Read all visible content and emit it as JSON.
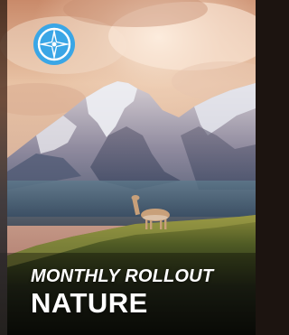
{
  "card": {
    "kicker": "MONTHLY ROLLOUT",
    "title": "NATURE",
    "badge_icon": "compass-star-icon"
  },
  "colors": {
    "badge_blue": "#3aa6e6",
    "text": "#ffffff"
  }
}
